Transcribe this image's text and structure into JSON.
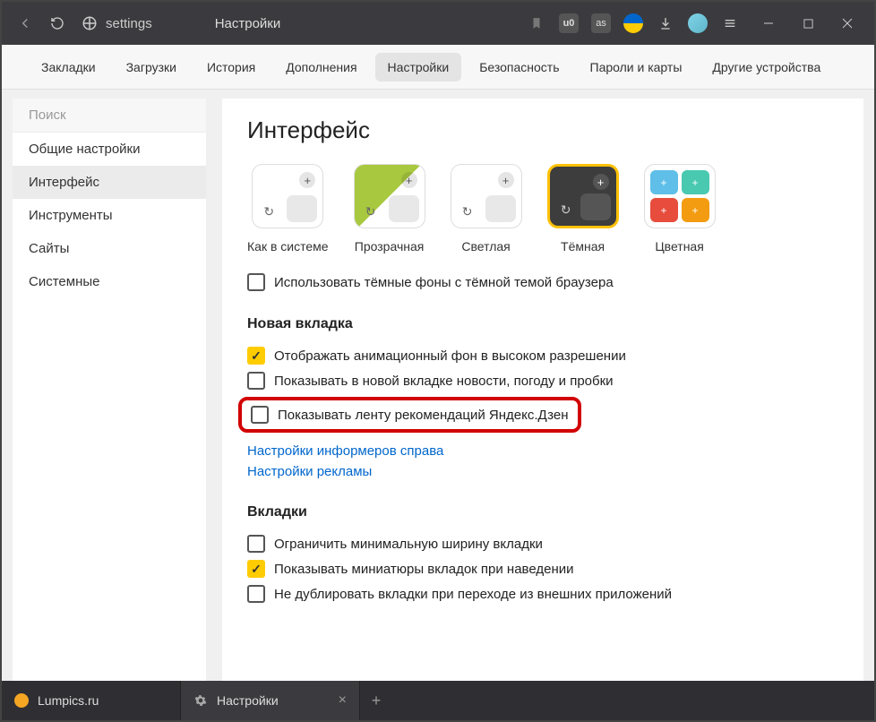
{
  "titlebar": {
    "url_label": "settings",
    "page_name": "Настройки"
  },
  "top_tabs": [
    {
      "label": "Закладки",
      "active": false
    },
    {
      "label": "Загрузки",
      "active": false
    },
    {
      "label": "История",
      "active": false
    },
    {
      "label": "Дополнения",
      "active": false
    },
    {
      "label": "Настройки",
      "active": true
    },
    {
      "label": "Безопасность",
      "active": false
    },
    {
      "label": "Пароли и карты",
      "active": false
    },
    {
      "label": "Другие устройства",
      "active": false
    }
  ],
  "sidebar": {
    "search_placeholder": "Поиск",
    "items": [
      {
        "label": "Общие настройки",
        "active": false
      },
      {
        "label": "Интерфейс",
        "active": true
      },
      {
        "label": "Инструменты",
        "active": false
      },
      {
        "label": "Сайты",
        "active": false
      },
      {
        "label": "Системные",
        "active": false
      }
    ]
  },
  "content": {
    "heading": "Интерфейс",
    "themes": [
      {
        "label": "Как в системе"
      },
      {
        "label": "Прозрачная"
      },
      {
        "label": "Светлая"
      },
      {
        "label": "Тёмная"
      },
      {
        "label": "Цветная"
      }
    ],
    "dark_bg_checkbox": "Использовать тёмные фоны с тёмной темой браузера",
    "section_newtab": "Новая вкладка",
    "newtab_options": [
      {
        "label": "Отображать анимационный фон в высоком разрешении",
        "checked": true
      },
      {
        "label": "Показывать в новой вкладке новости, погоду и пробки",
        "checked": false
      },
      {
        "label": "Показывать ленту рекомендаций Яндекс.Дзен",
        "checked": false
      }
    ],
    "links": [
      "Настройки информеров справа",
      "Настройки рекламы"
    ],
    "section_tabs": "Вкладки",
    "tabs_options": [
      {
        "label": "Ограничить минимальную ширину вкладки",
        "checked": false
      },
      {
        "label": "Показывать миниатюры вкладок при наведении",
        "checked": true
      },
      {
        "label": "Не дублировать вкладки при переходе из внешних приложений",
        "checked": false
      }
    ]
  },
  "bottom_tabs": [
    {
      "label": "Lumpics.ru",
      "icon_color": "#f5a623",
      "active": false
    },
    {
      "label": "Настройки",
      "icon_color": "#888",
      "active": true
    }
  ]
}
